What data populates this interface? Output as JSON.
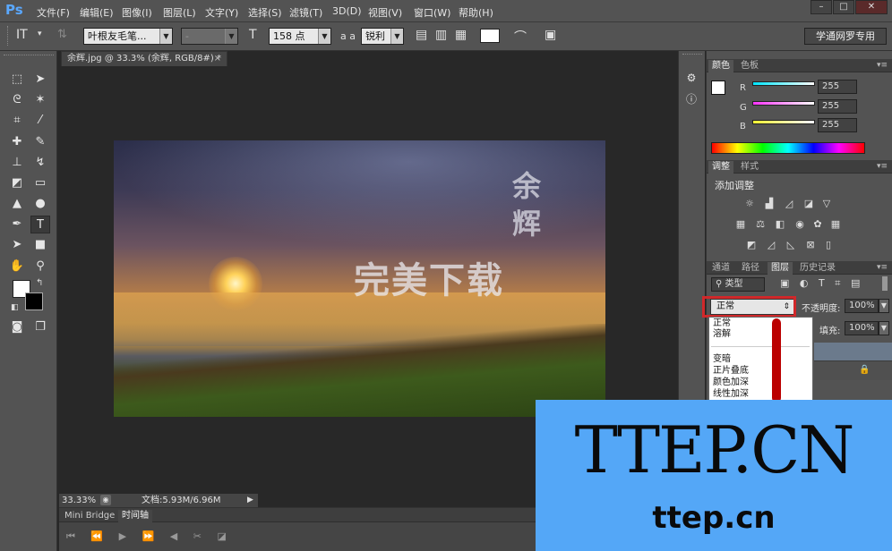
{
  "app": {
    "logo": "Ps"
  },
  "menu": [
    "文件(F)",
    "编辑(E)",
    "图像(I)",
    "图层(L)",
    "文字(Y)",
    "选择(S)",
    "滤镜(T)",
    "3D(D)",
    "视图(V)",
    "窗口(W)",
    "帮助(H)"
  ],
  "window_controls": {
    "minimize": "–",
    "maximize": "□",
    "close": "✕"
  },
  "options": {
    "tool_glyph": "IT",
    "font_family": "叶根友毛笔...",
    "font_style": "-",
    "font_size": "158 点",
    "aa_label": "a a",
    "antialias": "锐利",
    "workspace": "学通网罗专用"
  },
  "document": {
    "tab_title": "余辉.jpg @ 33.3% (余辉, RGB/8#) *",
    "tab_close": "×",
    "image_text_vertical": "余辉",
    "image_text_main": "完美下载",
    "zoom": "33.33%",
    "doc_size": "文档:5.93M/6.96M"
  },
  "bottom_panel": {
    "tabs": [
      "Mini Bridge",
      "时间轴"
    ]
  },
  "color_panel": {
    "tabs": [
      "颜色",
      "色板"
    ],
    "channels": [
      {
        "label": "R",
        "value": "255",
        "color": "#00e5ff"
      },
      {
        "label": "G",
        "value": "255",
        "color": "#ff33ff"
      },
      {
        "label": "B",
        "value": "255",
        "color": "#ffff33"
      }
    ]
  },
  "adjustments_panel": {
    "tabs": [
      "调整",
      "样式"
    ],
    "title": "添加调整"
  },
  "layers_panel": {
    "tabs": [
      "通道",
      "路径",
      "图层",
      "历史记录"
    ],
    "filter_kind": "类型",
    "blend_mode": "正常",
    "opacity_label": "不透明度:",
    "opacity_value": "100%",
    "fill_label": "填充:",
    "fill_value": "100%",
    "blend_options": [
      "正常",
      "溶解",
      "变暗",
      "正片叠底",
      "颜色加深",
      "线性加深"
    ]
  },
  "watermark": {
    "big": "TTEP.CN",
    "small": "ttep.cn"
  },
  "colors": {
    "accent_red": "#d0282a",
    "watermark_bg": "#54a7f7",
    "ui_gray": "#535353"
  }
}
